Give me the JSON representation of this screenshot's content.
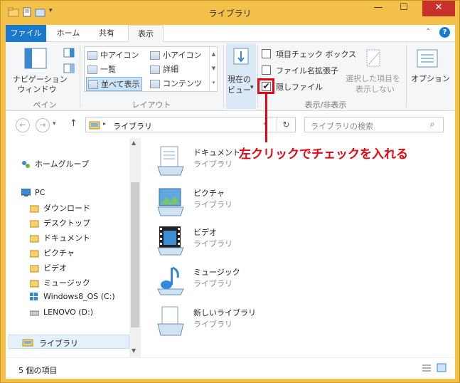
{
  "window": {
    "title": "ライブラリ"
  },
  "tabs": [
    {
      "label": "ファイル"
    },
    {
      "label": "ホーム"
    },
    {
      "label": "共有"
    },
    {
      "label": "表示"
    }
  ],
  "ribbon": {
    "pane": {
      "nav_pane_label_1": "ナビゲーション",
      "nav_pane_label_2": "ウィンドウ",
      "group": "ペイン"
    },
    "layout": {
      "items": [
        "中アイコン",
        "小アイコン",
        "一覧",
        "詳細",
        "並べて表示",
        "コンテンツ"
      ],
      "selected": "並べて表示",
      "group": "レイアウト"
    },
    "current_view": {
      "label_1": "現在の",
      "label_2": "ビュー"
    },
    "show_hide": {
      "item_checkboxes": "項目チェック ボックス",
      "file_extensions": "ファイル名拡張子",
      "hidden_items": "隠しファイル",
      "hidden_items_checked": true,
      "hide_selected_1": "選択した項目を",
      "hide_selected_2": "表示しない",
      "group": "表示/非表示"
    },
    "options": {
      "label": "オプション"
    }
  },
  "address": {
    "path": "ライブラリ",
    "search_placeholder": "ライブラリの検索"
  },
  "nav_pane": {
    "homegroup": "ホームグループ",
    "pc": "PC",
    "pc_items": [
      "ダウンロード",
      "デスクトップ",
      "ドキュメント",
      "ピクチャ",
      "ビデオ",
      "ミュージック",
      "Windows8_OS (C:)",
      "LENOVO (D:)"
    ],
    "libraries": "ライブラリ"
  },
  "libraries": [
    {
      "name": "ドキュメント",
      "sub": "ライブラリ"
    },
    {
      "name": "ピクチャ",
      "sub": "ライブラリ"
    },
    {
      "name": "ビデオ",
      "sub": "ライブラリ"
    },
    {
      "name": "ミュージック",
      "sub": "ライブラリ"
    },
    {
      "name": "新しいライブラリ",
      "sub": "ライブラリ"
    }
  ],
  "status": {
    "count": "5 個の項目"
  },
  "annotation": {
    "text": "左クリックでチェックを入れる",
    "color": "#e30613"
  }
}
